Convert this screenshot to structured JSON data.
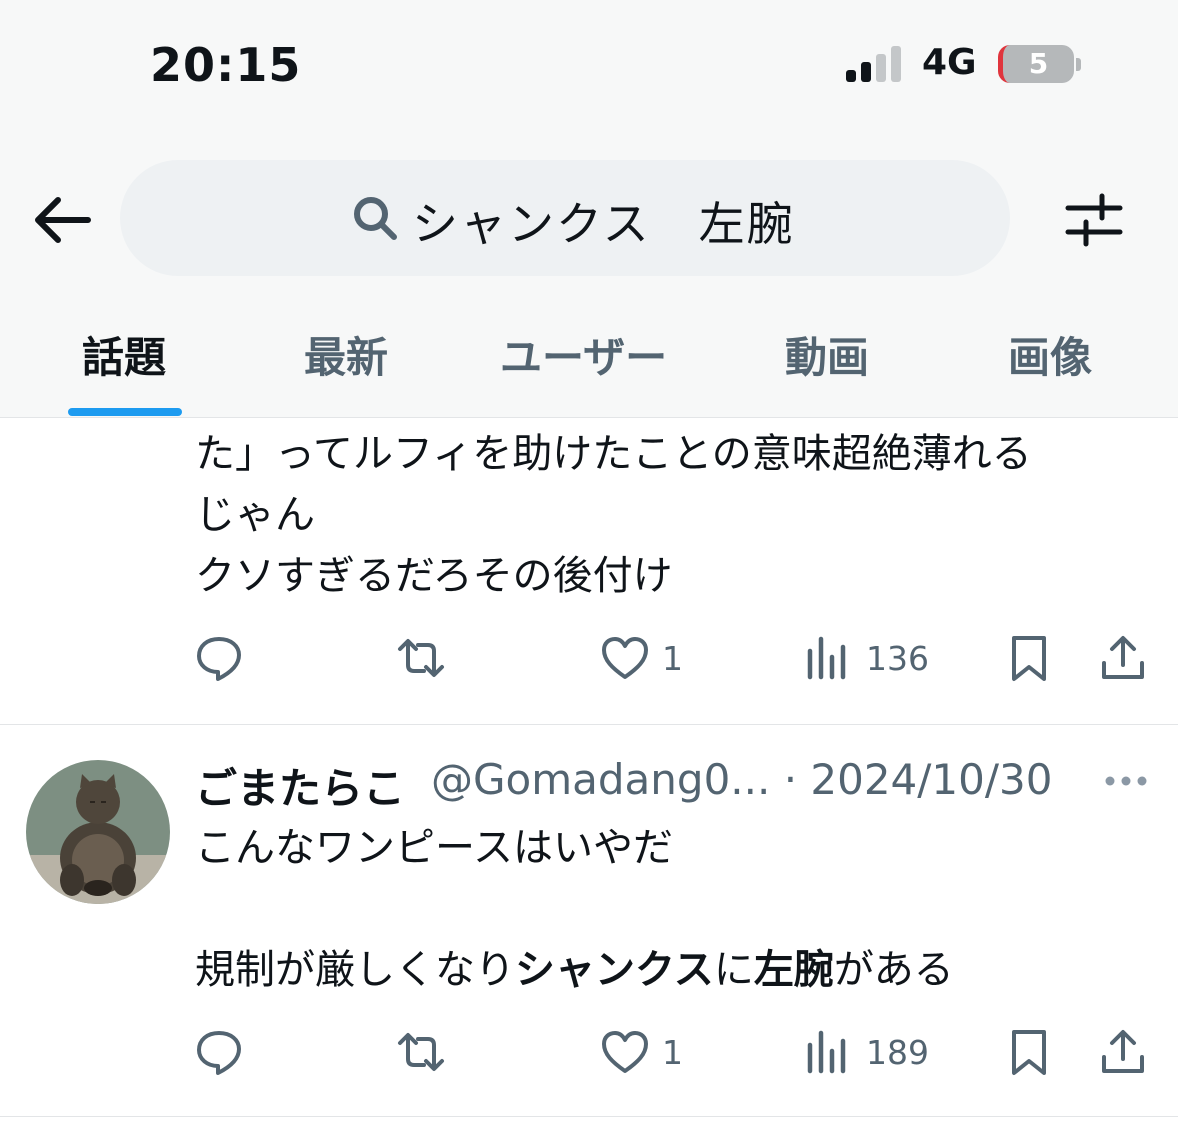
{
  "status_bar": {
    "time": "20:15",
    "network": "4G",
    "battery": "5"
  },
  "search": {
    "query": "シャンクス　左腕"
  },
  "tabs": [
    "話題",
    "最新",
    "ユーザー",
    "動画",
    "画像"
  ],
  "active_tab": "話題",
  "tweet1": {
    "lines": [
      "た」ってルフィを助けたことの意味超絶薄れる",
      "じゃん",
      "クソすぎるだろその後付け"
    ],
    "likes": "1",
    "views": "136"
  },
  "tweet2": {
    "name": "ごまたらこ",
    "handle": "@Gomadang0... · 2024/10/30",
    "line1": "こんなワンピースはいやだ",
    "line2_parts": [
      "規制が厳しくなり",
      "シャンクス",
      "に",
      "左腕",
      "がある"
    ],
    "likes": "1",
    "views": "189"
  },
  "icons": {
    "reply": "reply-icon",
    "retweet": "retweet-icon",
    "like": "heart-icon",
    "views": "views-icon",
    "bookmark": "bookmark-icon",
    "share": "share-icon",
    "back": "back-arrow-icon",
    "search": "search-icon",
    "filter": "filter-sliders-icon",
    "more": "more-dots-icon"
  },
  "colors": {
    "accent": "#1d9bf0",
    "secondary_text": "#536471",
    "text": "#0f1419"
  }
}
